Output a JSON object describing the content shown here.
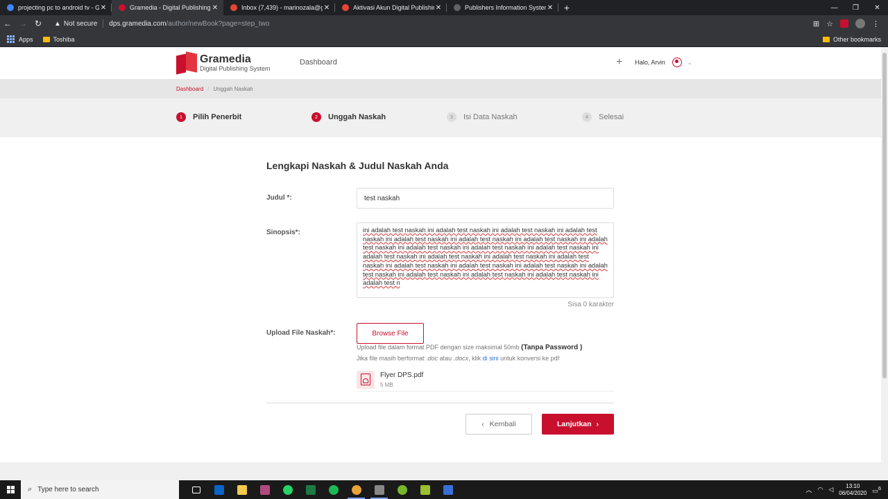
{
  "browser": {
    "tabs": [
      {
        "title": "projecting pc to android tv - Goo",
        "favicon_color": "#4285f4",
        "active": false
      },
      {
        "title": "Gramedia - Digital Publishing Sys",
        "favicon_color": "#c8102e",
        "active": true
      },
      {
        "title": "Inbox (7,439) - marinozala@gma",
        "favicon_color": "#ea4335",
        "active": false
      },
      {
        "title": "Aktivasi Akun Digital Publishing S",
        "favicon_color": "#ea4335",
        "active": false
      },
      {
        "title": "Publishers Information System V",
        "favicon_color": "#5f6368",
        "active": false
      }
    ],
    "new_tab": "+",
    "security": "Not secure",
    "url_host": "dps.gramedia.com",
    "url_path": "/author/newBook?page=step_two",
    "bookmarks": {
      "apps": "Apps",
      "toshiba": "Toshiba",
      "other": "Other bookmarks"
    }
  },
  "header": {
    "brand": "Gramedia",
    "brand_sub": "Digital Publishing System",
    "nav_dashboard": "Dashboard",
    "plus": "+",
    "greeting": "Halo, Arvin"
  },
  "breadcrumb": {
    "link": "Dashboard",
    "current": "Unggah Naskah"
  },
  "steps": [
    {
      "num": "1",
      "label": "Pilih Penerbit",
      "state": "done"
    },
    {
      "num": "2",
      "label": "Unggah Naskah",
      "state": "done"
    },
    {
      "num": "3",
      "label": "Isi Data Naskah",
      "state": "todo"
    },
    {
      "num": "4",
      "label": "Selesai",
      "state": "todo"
    }
  ],
  "form": {
    "title": "Lengkapi Naskah & Judul Naskah Anda",
    "judul_label": "Judul *:",
    "judul_value": "test naskah",
    "sinopsis_label": "Sinopsis*:",
    "sinopsis_value": "ini adalah test naskah ini adalah test naskah ini adalah test naskah ini adalah test naskah ini adalah test naskah ini adalah test naskah ini adalah test naskah ini adalah test naskah ini adalah test naskah ini adalah test naskah ini adalah test naskah ini adalah test naskah ini adalah test naskah ini adalah test naskah ini adalah test naskah ini adalah test naskah ini adalah test naskah ini adalah test naskah ini adalah test naskah ini adalah test naskah ini adalah test naskah ini adalah test naskah ini adalah test n",
    "counter": "Sisa 0 karakter",
    "upload_label": "Upload File Naskah*:",
    "browse_label": "Browse File",
    "hint_main": "Upload file dalam format PDF dengan size maksimal 50mb",
    "hint_bold": "(Tanpa Password )",
    "hint2_a": "Jika file masih berformat ",
    "hint2_doc": ".doc",
    "hint2_b": " atau ",
    "hint2_docx": ".docx",
    "hint2_c": ", klik ",
    "hint2_link": "di sini",
    "hint2_d": " untuk konversi ke pdf",
    "file_name": "Flyer DPS.pdf",
    "file_size": "5 MB",
    "back_label": "Kembali",
    "next_label": "Lanjutkan"
  },
  "taskbar": {
    "search_placeholder": "Type here to search",
    "time": "13:10",
    "date": "06/04/2020",
    "notif_count": "6"
  },
  "colors": {
    "accent": "#c8102e"
  }
}
